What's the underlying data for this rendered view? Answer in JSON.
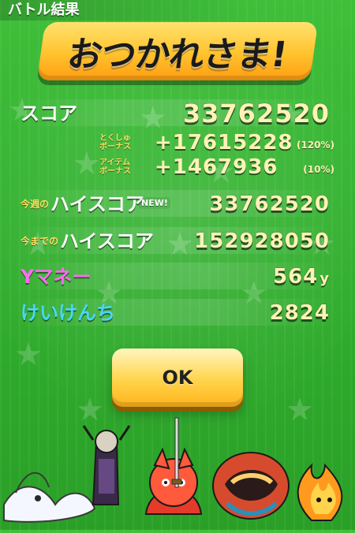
{
  "header": {
    "title": "バトル結果"
  },
  "banner": {
    "text": "おつかれさま!"
  },
  "rows": {
    "score": {
      "label": "スコア",
      "value": "33762520"
    },
    "bonus_tokushu": {
      "label_line1": "とくしゅ",
      "label_line2": "ボーナス",
      "value": "+17615228",
      "pct": "(120%)"
    },
    "bonus_item": {
      "label_line1": "アイテム",
      "label_line2": "ボーナス",
      "value": "+1467936",
      "pct": "(10%)"
    },
    "weekly_high": {
      "prefix": "今週の",
      "label": "ハイスコア",
      "new_badge": "NEW!",
      "value": "33762520"
    },
    "all_time_high": {
      "prefix": "今までの",
      "label": "ハイスコア",
      "value": "152928050"
    },
    "money": {
      "label": "Yマネー",
      "value": "564",
      "unit": "y"
    },
    "exp": {
      "label": "けいけんち",
      "value": "2824"
    }
  },
  "button": {
    "ok_label": "OK"
  },
  "colors": {
    "bg_green": "#37b433",
    "value_yellow": "#fff2b6",
    "label_yellow": "#ffdf5c",
    "money_label": "#ff6bf4",
    "exp_label": "#49d7ff",
    "title_gold": "#ffc22d"
  },
  "icons": {
    "background": "star-pattern",
    "characters": [
      "white-fox-yokai",
      "samurai-yokai",
      "red-cat-warrior",
      "big-mouth-yokai",
      "fire-yokai"
    ]
  }
}
